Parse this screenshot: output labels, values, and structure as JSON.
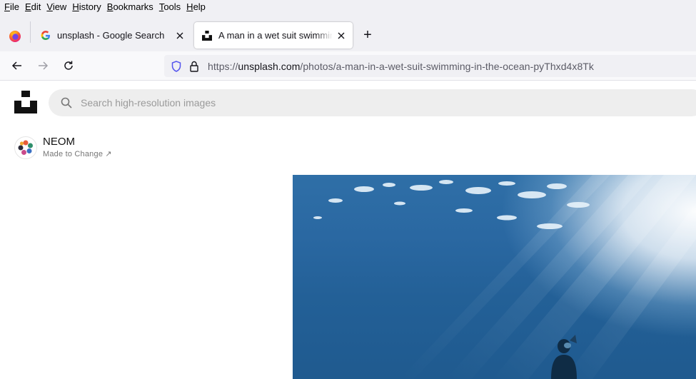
{
  "menu": [
    "File",
    "Edit",
    "View",
    "History",
    "Bookmarks",
    "Tools",
    "Help"
  ],
  "tabs": [
    {
      "title": "unsplash - Google Search",
      "favicon": "google-icon",
      "active": false
    },
    {
      "title": "A man in a wet suit swimming in the ocean",
      "favicon": "unsplash-icon",
      "active": true
    }
  ],
  "new_tab_label": "+",
  "url": {
    "prefix": "https://",
    "host": "unsplash.com",
    "path": "/photos/a-man-in-a-wet-suit-swimming-in-the-ocean-pyThxd4x8Tk"
  },
  "search": {
    "placeholder": "Search high-resolution images"
  },
  "author": {
    "name": "NEOM",
    "subtitle": "Made to Change ↗"
  },
  "photo": {
    "alt": "A man in a wet suit swimming in the ocean"
  },
  "colors": {
    "chrome": "#f0f0f4",
    "navbar": "#f9f9fb",
    "search_bg": "#eeeeee",
    "water": "#236097"
  }
}
